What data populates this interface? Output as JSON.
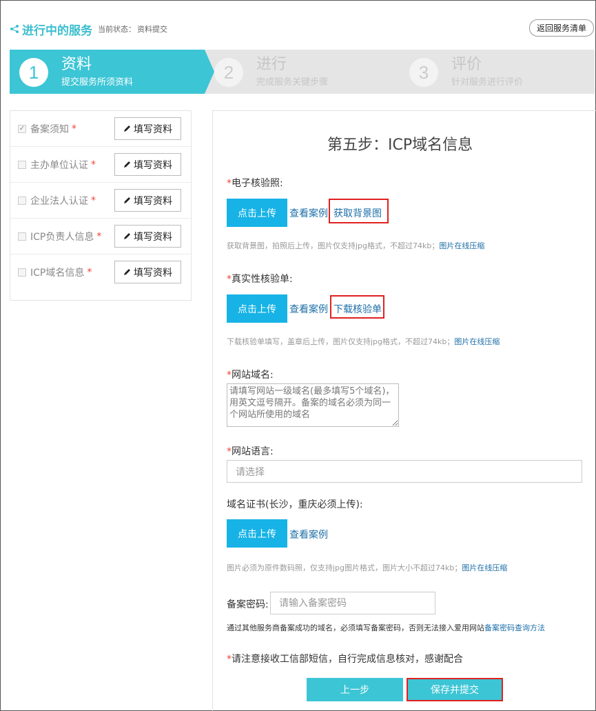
{
  "header": {
    "title": "进行中的服务",
    "state_label": "当前状态：",
    "state_value": "资料提交",
    "back_button": "返回服务清单"
  },
  "steps": [
    {
      "num": "1",
      "label": "资料",
      "sub": "提交服务所须资料",
      "active": true
    },
    {
      "num": "2",
      "label": "进行",
      "sub": "完成服务关键步骤",
      "active": false
    },
    {
      "num": "3",
      "label": "评价",
      "sub": "针对服务进行评价",
      "active": false
    }
  ],
  "sidebar": {
    "items": [
      {
        "label": "备案须知",
        "checked": true,
        "button": "填写资料"
      },
      {
        "label": "主办单位认证",
        "checked": false,
        "button": "填写资料"
      },
      {
        "label": "企业法人认证",
        "checked": false,
        "button": "填写资料"
      },
      {
        "label": "ICP负责人信息",
        "checked": false,
        "button": "填写资料"
      },
      {
        "label": "ICP域名信息",
        "checked": false,
        "button": "填写资料"
      }
    ],
    "required_mark": "*"
  },
  "main": {
    "title": "第五步：ICP域名信息",
    "required_mark": "*",
    "ecert": {
      "label": "电子核验照:",
      "upload": "点击上传",
      "example": "查看案例",
      "extra_link": "获取背景图",
      "hint": "获取背景图，拍照后上传，图片仅支持jpg格式，不超过74kb；",
      "hint_link": "图片在线压缩"
    },
    "verify": {
      "label": "真实性核验单:",
      "upload": "点击上传",
      "example": "查看案例",
      "extra_link": "下载核验单",
      "hint": "下载核验单填写，盖章后上传，图片仅支持jpg格式，不超过74kb；",
      "hint_link": "图片在线压缩"
    },
    "domain": {
      "label": "网站域名:",
      "placeholder": "请填写网站一级域名(最多填写5个域名)，用英文逗号隔开。备案的域名必须为同一个网站所使用的域名"
    },
    "language": {
      "label": "网站语言:",
      "placeholder": "请选择"
    },
    "domain_cert": {
      "label": "域名证书(长沙，重庆必须上传):",
      "upload": "点击上传",
      "example": "查看案例",
      "hint": "图片必须为原件数码照，仅支持jpg图片格式，图片大小不超过74kb；",
      "hint_link": "图片在线压缩"
    },
    "password": {
      "label": "备案密码:",
      "placeholder": "请输入备案密码",
      "hint": "通过其他服务商备案成功的域名，必须填写备案密码，否则无法接入爱用网站",
      "hint_link": "备案密码查询方法"
    },
    "notice": "请注意接收工信部短信，自行完成信息核对，感谢配合",
    "prev_button": "上一步",
    "save_button": "保存并提交"
  },
  "colors": {
    "accent": "#3cc5d5",
    "upload": "#17b3e6",
    "link": "#1d6fa8",
    "required": "#e43",
    "highlight_box": "#e02020"
  }
}
